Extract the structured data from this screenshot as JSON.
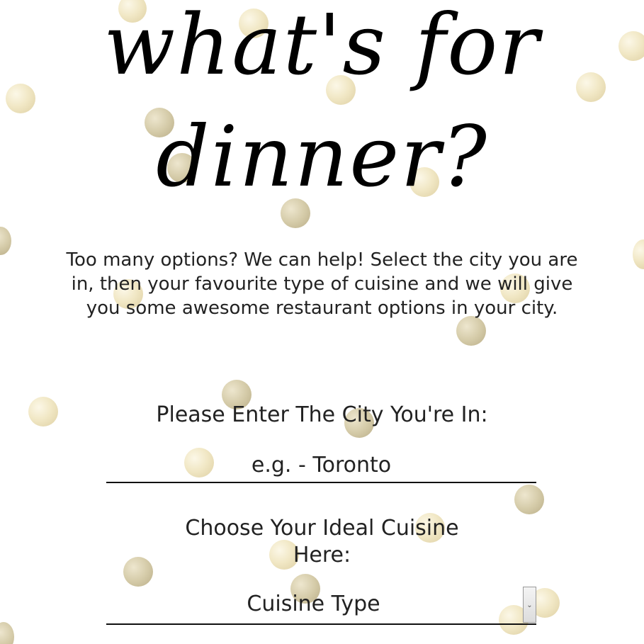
{
  "header": {
    "title_line1": "what's for",
    "title_line2": "dinner?"
  },
  "intro": {
    "text": "Too many options? We can help! Select the city you are in, then your favourite type of cuisine and we will give you some awesome restaurant options in your city."
  },
  "city_form": {
    "label": "Please Enter The City You're In:",
    "placeholder": "e.g. - Toronto",
    "value": ""
  },
  "cuisine_form": {
    "label": "Choose Your Ideal Cuisine Here:",
    "selected": "Cuisine Type",
    "dropdown_icon": "chevron-down-icon"
  },
  "colors": {
    "background": "#ffffff",
    "text": "#222222",
    "title": "#000000",
    "confetti_gold": "#e8dcae"
  }
}
